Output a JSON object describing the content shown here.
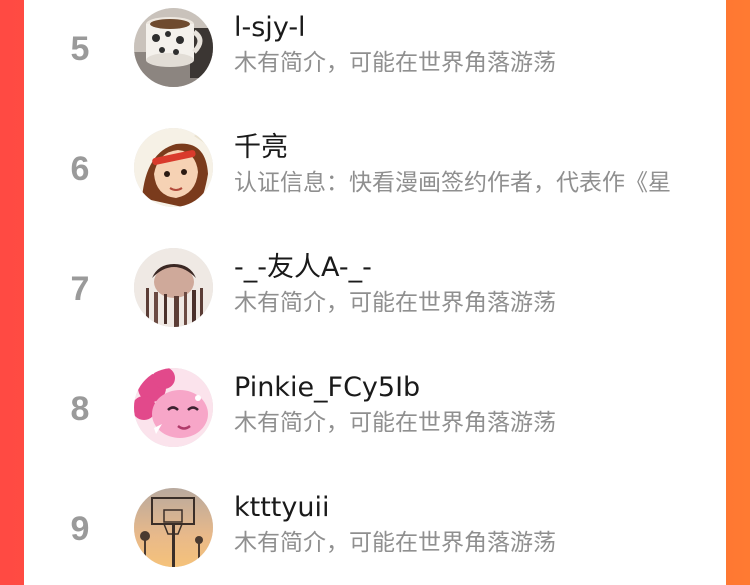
{
  "colors": {
    "background_left": "#ff4a43",
    "background_right": "#ff7a32",
    "rank": "#9a9a9a",
    "name": "#1a1a1a",
    "desc": "#8f8f8f"
  },
  "users": [
    {
      "rank": "5",
      "name": "l-sjy-l",
      "desc": "木有简介，可能在世界角落游荡",
      "avatar": "mug-photo"
    },
    {
      "rank": "6",
      "name": "千亮",
      "desc": "认证信息：快看漫画签约作者，代表作《星",
      "avatar": "manga-girl-illustration"
    },
    {
      "rank": "7",
      "name": "-_-友人A-_-",
      "desc": "木有简介，可能在世界角落游荡",
      "avatar": "portrait-photo"
    },
    {
      "rank": "8",
      "name": "Pinkie_FCy5Ib",
      "desc": "木有简介，可能在世界角落游荡",
      "avatar": "pink-pony-illustration"
    },
    {
      "rank": "9",
      "name": "ktttyuii",
      "desc": "木有简介，可能在世界角落游荡",
      "avatar": "basketball-hoop-sunset-photo"
    }
  ]
}
